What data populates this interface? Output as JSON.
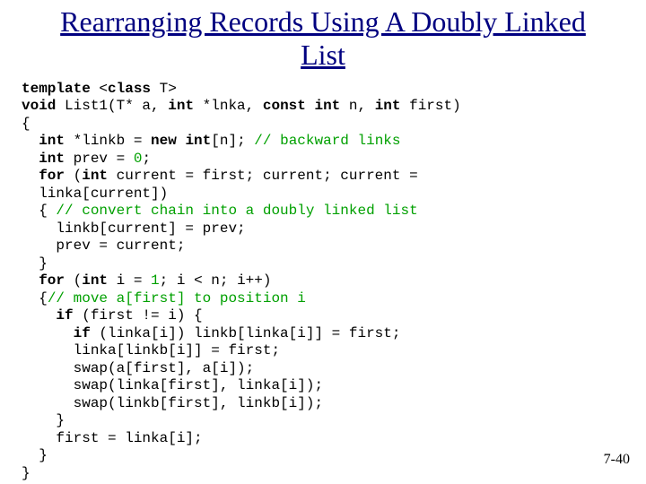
{
  "title": "Rearranging Records Using A Doubly Linked List",
  "code": {
    "l1a": "template",
    "l1b": " <",
    "l1c": "class",
    "l1d": " T>",
    "l2a": "void",
    "l2b": " List1(T* a, ",
    "l2c": "int",
    "l2d": " *lnka, ",
    "l2e": "const int",
    "l2f": " n, ",
    "l2g": "int",
    "l2h": " first)",
    "l3": "{",
    "l4a": "  ",
    "l4b": "int",
    "l4c": " *linkb = ",
    "l4d": "new",
    "l4e": " ",
    "l4f": "int",
    "l4g": "[n]; ",
    "l4h": "// backward links",
    "l5a": "  ",
    "l5b": "int",
    "l5c": " prev = ",
    "l5d": "0",
    "l5e": ";",
    "l6a": "  ",
    "l6b": "for",
    "l6c": " (",
    "l6d": "int",
    "l6e": " current = first; current; current =",
    "l7": "  linka[current])",
    "l8a": "  { ",
    "l8b": "// convert chain into a doubly linked list",
    "l9": "    linkb[current] = prev;",
    "l10": "    prev = current;",
    "l11": "  }",
    "l12a": "  ",
    "l12b": "for",
    "l12c": " (",
    "l12d": "int",
    "l12e": " i = ",
    "l12f": "1",
    "l12g": "; i < n; i++)",
    "l13a": "  {",
    "l13b": "// move a[first] to position i",
    "l14a": "    ",
    "l14b": "if",
    "l14c": " (first != i) {",
    "l15a": "      ",
    "l15b": "if",
    "l15c": " (linka[i]) linkb[linka[i]] = first;",
    "l16": "      linka[linkb[i]] = first;",
    "l17": "      swap(a[first], a[i]);",
    "l18": "      swap(linka[first], linka[i]);",
    "l19": "      swap(linkb[first], linkb[i]);",
    "l20": "    }",
    "l21": "    first = linka[i];",
    "l22": "  }",
    "l23": "}"
  },
  "pageno": "7-40"
}
